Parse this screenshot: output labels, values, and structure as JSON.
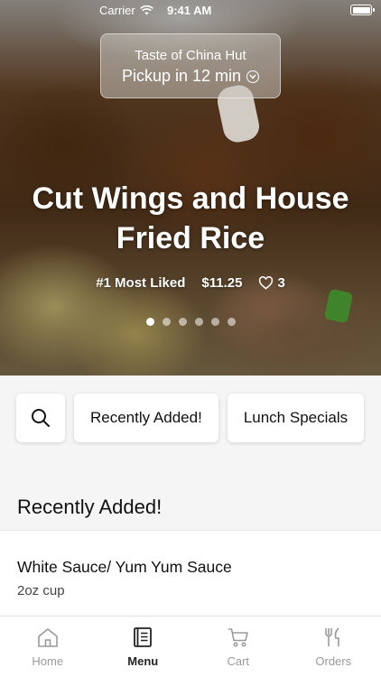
{
  "status_bar": {
    "carrier": "Carrier",
    "time": "9:41 AM"
  },
  "pickup": {
    "store_name": "Taste of China Hut",
    "pickup_text": "Pickup in 12 min"
  },
  "hero": {
    "title": "Cut Wings and House Fried Rice",
    "rank": "#1 Most Liked",
    "price": "$11.25",
    "likes": "3",
    "carousel": {
      "count": 6,
      "active_index": 0
    }
  },
  "categories": [
    {
      "icon": "search-icon"
    },
    {
      "label": "Recently Added!"
    },
    {
      "label": "Lunch Specials"
    }
  ],
  "section": {
    "title": "Recently Added!"
  },
  "items": [
    {
      "name": "White Sauce/ Yum Yum Sauce",
      "description": "2oz cup"
    }
  ],
  "tab_bar": {
    "tabs": [
      {
        "label": "Home",
        "icon": "home-icon"
      },
      {
        "label": "Menu",
        "icon": "menu-book-icon",
        "active": true
      },
      {
        "label": "Cart",
        "icon": "cart-icon"
      },
      {
        "label": "Orders",
        "icon": "fork-knife-icon"
      }
    ]
  }
}
